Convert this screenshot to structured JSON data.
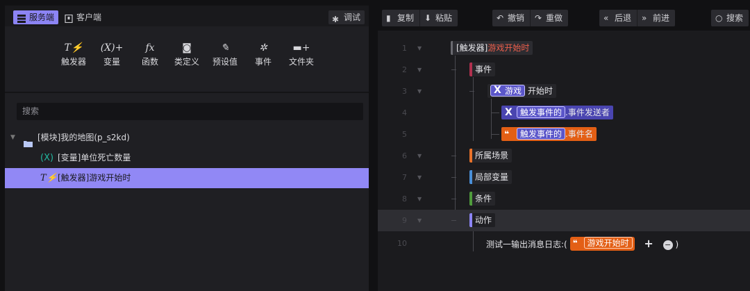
{
  "left": {
    "tabs": [
      {
        "label": "服务端",
        "icon": "server-icon"
      },
      {
        "label": "客户端",
        "icon": "client-icon"
      }
    ],
    "debug_label": "调试",
    "categories": [
      {
        "label": "触发器",
        "glyph": "T⚡"
      },
      {
        "label": "变量",
        "glyph": "(X)+"
      },
      {
        "label": "函数",
        "glyph": "fx"
      },
      {
        "label": "类定义",
        "glyph": "◙"
      },
      {
        "label": "预设值",
        "glyph": "✎"
      },
      {
        "label": "事件",
        "glyph": "✲"
      },
      {
        "label": "文件夹",
        "glyph": "▬+"
      }
    ],
    "search_placeholder": "搜索",
    "tree": {
      "module": "[模块]我的地图(p_s2kd)",
      "variable": "[变量]单位死亡数量",
      "trigger": "[触发器]游戏开始时"
    }
  },
  "toolbar": {
    "copy": "复制",
    "paste": "粘贴",
    "undo": "撤销",
    "redo": "重做",
    "back": "后退",
    "forward": "前进",
    "search": "搜索"
  },
  "editor": {
    "line_numbers": [
      "1",
      "2",
      "3",
      "4",
      "5",
      "6",
      "7",
      "8",
      "9",
      "10"
    ],
    "header_prefix": "[触发器]",
    "header_name": "游戏开始时",
    "event_label": "事件",
    "event_game": "游戏",
    "event_start": "开始时",
    "sender_pill": "触发事件的",
    "sender_suffix": ".事件发送者",
    "name_pill": "触发事件的",
    "name_suffix": ".事件名",
    "scene_label": "所属场景",
    "local_var_label": "局部变量",
    "condition_label": "条件",
    "action_label": "动作",
    "action_stmt_prefix": "测试一输出消息日志:(",
    "action_stmt_pill": "游戏开始时",
    "action_stmt_plus": "+",
    "action_stmt_minus": "−",
    "action_stmt_close": ")"
  },
  "colors": {
    "accent": "#9188f5",
    "event_bar": "#b0304e",
    "scene_bar": "#e8722a",
    "var_bar": "#4a8fd8",
    "cond_bar": "#4f9c3c",
    "action_bar": "#8c84f4",
    "pill_orange": "#e35f15",
    "pill_purple": "#5b56c9"
  }
}
